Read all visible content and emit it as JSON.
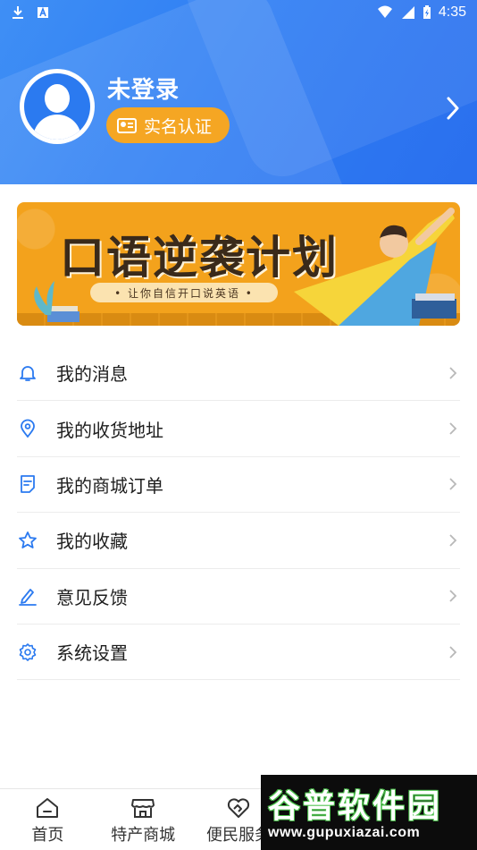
{
  "status_bar": {
    "time": "4:35"
  },
  "profile": {
    "username": "未登录",
    "verify_label": "实名认证"
  },
  "banner": {
    "title": "口语逆袭计划",
    "subtitle": "• 让你自信开口说英语 •"
  },
  "menu": {
    "items": [
      {
        "label": "我的消息",
        "icon": "bell-icon"
      },
      {
        "label": "我的收货地址",
        "icon": "location-pin-icon"
      },
      {
        "label": "我的商城订单",
        "icon": "document-icon"
      },
      {
        "label": "我的收藏",
        "icon": "star-icon"
      },
      {
        "label": "意见反馈",
        "icon": "edit-pen-icon"
      },
      {
        "label": "系统设置",
        "icon": "gear-icon"
      }
    ]
  },
  "bottom_nav": {
    "items": [
      {
        "label": "首页",
        "icon": "home-icon"
      },
      {
        "label": "特产商城",
        "icon": "store-icon"
      },
      {
        "label": "便民服务",
        "icon": "heart-hands-icon"
      }
    ]
  },
  "watermark": {
    "title": "谷普软件园",
    "url": "www.gupuxiazai.com"
  },
  "colors": {
    "header_blue": "#2f7ef3",
    "accent_blue": "#2b7af0",
    "verify_orange": "#f5a623",
    "banner_orange": "#f3a21c"
  }
}
